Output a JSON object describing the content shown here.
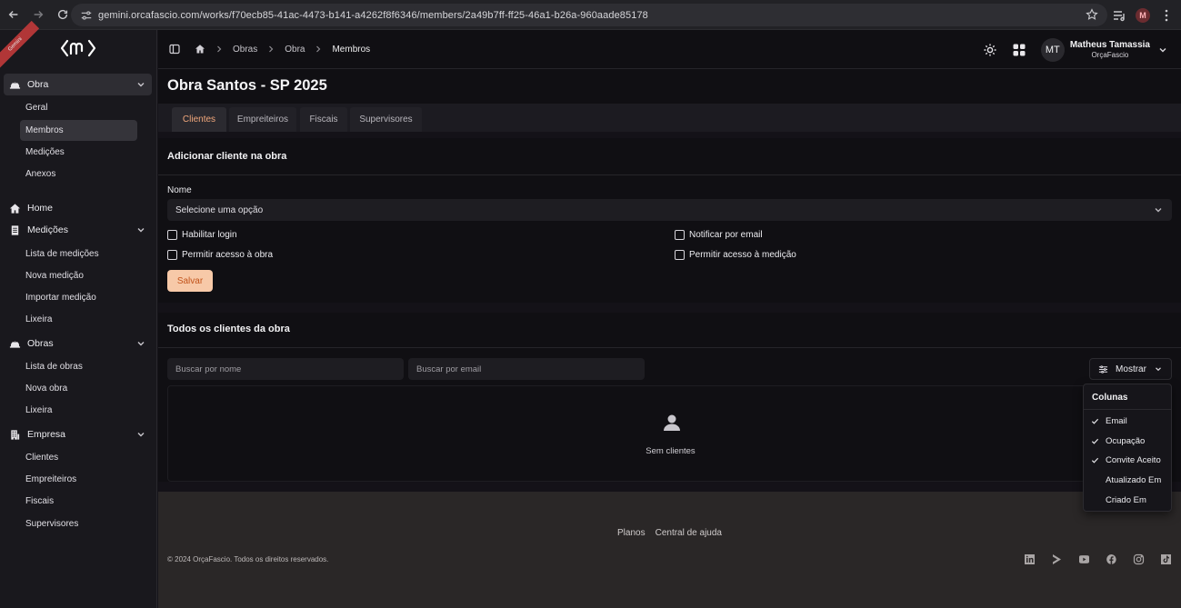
{
  "browser": {
    "url": "gemini.orcafascio.com/works/f70ecb85-41ac-4473-b141-a4262f8f6346/members/2a49b7ff-ff25-46a1-b26a-960aade85178",
    "profile_initial": "M"
  },
  "sidebar": {
    "ribbon": "Gemini",
    "sections": [
      {
        "label": "Obra",
        "icon": "hardhat-icon",
        "items": [
          "Geral",
          "Membros",
          "Medições",
          "Anexos"
        ],
        "active_item": "Membros"
      },
      {
        "label": "Home",
        "icon": "home-icon",
        "items": []
      },
      {
        "label": "Medições",
        "icon": "clipboard-icon",
        "items": [
          "Lista de medições",
          "Nova medição",
          "Importar medição",
          "Lixeira"
        ]
      },
      {
        "label": "Obras",
        "icon": "hardhat-icon",
        "items": [
          "Lista de obras",
          "Nova obra",
          "Lixeira"
        ]
      },
      {
        "label": "Empresa",
        "icon": "building-icon",
        "items": [
          "Clientes",
          "Empreiteiros",
          "Fiscais",
          "Supervisores"
        ]
      }
    ]
  },
  "topbar": {
    "breadcrumb": [
      "Obras",
      "Obra",
      "Membros"
    ],
    "user": {
      "initials": "MT",
      "name": "Matheus Tamassia",
      "org": "OrçaFascio"
    }
  },
  "page": {
    "title": "Obra Santos - SP 2025",
    "tabs": [
      "Clientes",
      "Empreiteiros",
      "Fiscais",
      "Supervisores"
    ],
    "active_tab": "Clientes"
  },
  "add_form": {
    "title": "Adicionar cliente na obra",
    "name_label": "Nome",
    "select_placeholder": "Selecione uma opção",
    "checkboxes": [
      "Habilitar login",
      "Notificar por email",
      "Permitir acesso à obra",
      "Permitir acesso à medição"
    ],
    "save_label": "Salvar"
  },
  "list": {
    "title": "Todos os clientes da obra",
    "search_name_placeholder": "Buscar por nome",
    "search_email_placeholder": "Buscar por email",
    "show_label": "Mostrar",
    "empty_text": "Sem clientes"
  },
  "columns_menu": {
    "title": "Colunas",
    "items": [
      {
        "label": "Email",
        "checked": true
      },
      {
        "label": "Ocupação",
        "checked": true
      },
      {
        "label": "Convite Aceito",
        "checked": true
      },
      {
        "label": "Atualizado Em",
        "checked": false
      },
      {
        "label": "Criado Em",
        "checked": false
      }
    ]
  },
  "footer": {
    "links": [
      "Planos",
      "Central de ajuda"
    ],
    "copyright": "© 2024 OrçaFascio. Todos os direitos reservados.",
    "socials": [
      "linkedin-icon",
      "play-icon",
      "youtube-icon",
      "facebook-icon",
      "instagram-icon",
      "tiktok-icon"
    ]
  },
  "colors": {
    "accent": "#f2a87c",
    "button_bg": "#f7c9a8",
    "button_text": "#c2531a"
  }
}
